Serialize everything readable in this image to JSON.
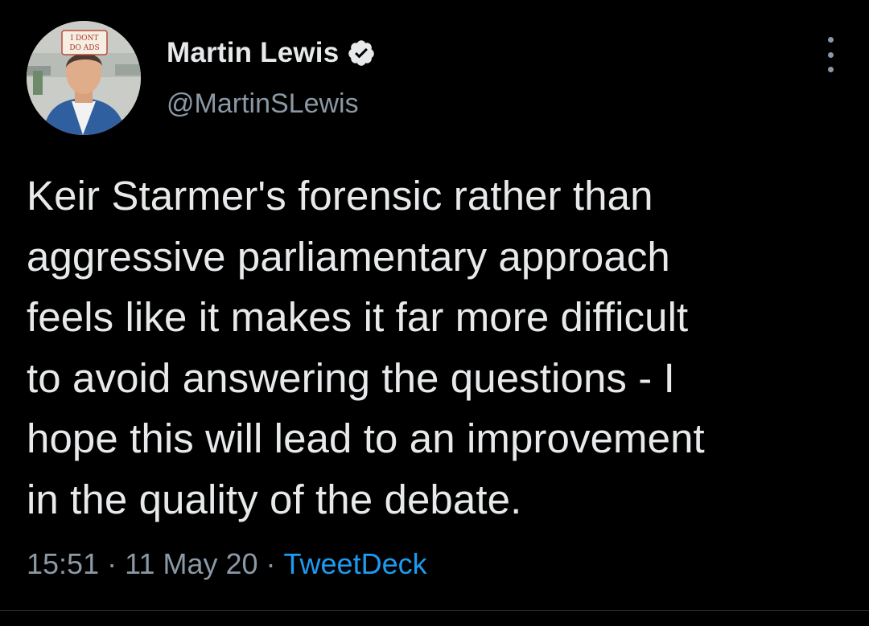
{
  "author": {
    "display_name": "Martin Lewis",
    "handle": "@MartinSLewis",
    "verified": true,
    "avatar_sign_text": [
      "I DONT",
      "DO ADS"
    ]
  },
  "tweet": {
    "text": "Keir Starmer's forensic rather than\naggressive parliamentary approach\nfeels like it makes it far more difficult\nto avoid answering the questions - I\nhope this will lead to an improvement\nin the quality of the debate.",
    "time": "15:51",
    "date": "11 May 20",
    "source": "TweetDeck",
    "separator": "·"
  },
  "icons": {
    "verified": "verified-badge-icon",
    "more": "more-vertical-icon"
  },
  "colors": {
    "background": "#000000",
    "text": "#e7e9ea",
    "muted": "#8b98a5",
    "link": "#1d9bf0"
  }
}
